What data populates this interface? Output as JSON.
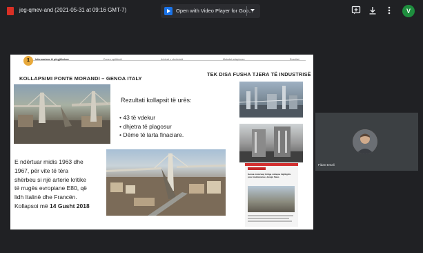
{
  "topbar": {
    "file_title": "jeg-qmev-and (2021-05-31 at 09:16 GMT-7)",
    "open_with": "Open with Video Player for Goo...",
    "avatar_letter": "V",
    "icons": [
      "add-comment-icon",
      "download-icon",
      "more-vert-icon"
    ]
  },
  "slide": {
    "progress": {
      "active_step": "1",
      "steps": [
        "Informacione të përgjithshme",
        "Puna e aplikimit",
        "Arkivat e vlerësimit",
        "Metodat adaptuese",
        "Rezultat"
      ]
    },
    "title_left": "KOLLAPSIMI PONTE MORANDI – GENOA ITALY",
    "title_right": "TEK DISA FUSHA TJERA TË INDUSTRISË",
    "results_title": "Rezultati  kollapsit të urës:",
    "bullets": [
      "43 të vdekur",
      "dhjetra të plagosur",
      "Dëme të larta finaciare."
    ],
    "description": [
      "E ndërtuar midis 1963 dhe",
      "1967, për vite të tëra",
      "shërbeu si një arterie kritike",
      "të rrugës evropiane E80, që",
      "lidh Italinë dhe Francën.",
      "Kollapsoi më "
    ],
    "description_date": "14 Gusht 2018",
    "news_headline": "Genoa motorway bridge collapse highlights poor maintenance, design flaws"
  },
  "participant": {
    "name": "Fidan Emali"
  },
  "colors": {
    "background": "#202124",
    "tile": "#3c4043",
    "step_accent": "#e8a93b",
    "avatar_green": "#1e8e3e"
  }
}
